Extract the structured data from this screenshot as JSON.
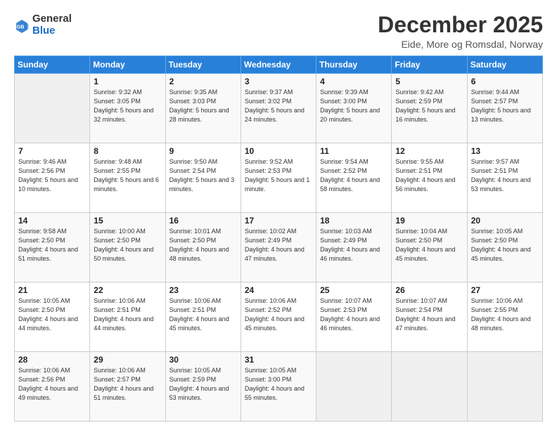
{
  "logo": {
    "general": "General",
    "blue": "Blue"
  },
  "header": {
    "month": "December 2025",
    "location": "Eide, More og Romsdal, Norway"
  },
  "weekdays": [
    "Sunday",
    "Monday",
    "Tuesday",
    "Wednesday",
    "Thursday",
    "Friday",
    "Saturday"
  ],
  "weeks": [
    [
      {
        "day": null,
        "info": null
      },
      {
        "day": "1",
        "info": "Sunrise: 9:32 AM\nSunset: 3:05 PM\nDaylight: 5 hours\nand 32 minutes."
      },
      {
        "day": "2",
        "info": "Sunrise: 9:35 AM\nSunset: 3:03 PM\nDaylight: 5 hours\nand 28 minutes."
      },
      {
        "day": "3",
        "info": "Sunrise: 9:37 AM\nSunset: 3:02 PM\nDaylight: 5 hours\nand 24 minutes."
      },
      {
        "day": "4",
        "info": "Sunrise: 9:39 AM\nSunset: 3:00 PM\nDaylight: 5 hours\nand 20 minutes."
      },
      {
        "day": "5",
        "info": "Sunrise: 9:42 AM\nSunset: 2:59 PM\nDaylight: 5 hours\nand 16 minutes."
      },
      {
        "day": "6",
        "info": "Sunrise: 9:44 AM\nSunset: 2:57 PM\nDaylight: 5 hours\nand 13 minutes."
      }
    ],
    [
      {
        "day": "7",
        "info": "Sunrise: 9:46 AM\nSunset: 2:56 PM\nDaylight: 5 hours\nand 10 minutes."
      },
      {
        "day": "8",
        "info": "Sunrise: 9:48 AM\nSunset: 2:55 PM\nDaylight: 5 hours\nand 6 minutes."
      },
      {
        "day": "9",
        "info": "Sunrise: 9:50 AM\nSunset: 2:54 PM\nDaylight: 5 hours\nand 3 minutes."
      },
      {
        "day": "10",
        "info": "Sunrise: 9:52 AM\nSunset: 2:53 PM\nDaylight: 5 hours\nand 1 minute."
      },
      {
        "day": "11",
        "info": "Sunrise: 9:54 AM\nSunset: 2:52 PM\nDaylight: 4 hours\nand 58 minutes."
      },
      {
        "day": "12",
        "info": "Sunrise: 9:55 AM\nSunset: 2:51 PM\nDaylight: 4 hours\nand 56 minutes."
      },
      {
        "day": "13",
        "info": "Sunrise: 9:57 AM\nSunset: 2:51 PM\nDaylight: 4 hours\nand 53 minutes."
      }
    ],
    [
      {
        "day": "14",
        "info": "Sunrise: 9:58 AM\nSunset: 2:50 PM\nDaylight: 4 hours\nand 51 minutes."
      },
      {
        "day": "15",
        "info": "Sunrise: 10:00 AM\nSunset: 2:50 PM\nDaylight: 4 hours\nand 50 minutes."
      },
      {
        "day": "16",
        "info": "Sunrise: 10:01 AM\nSunset: 2:50 PM\nDaylight: 4 hours\nand 48 minutes."
      },
      {
        "day": "17",
        "info": "Sunrise: 10:02 AM\nSunset: 2:49 PM\nDaylight: 4 hours\nand 47 minutes."
      },
      {
        "day": "18",
        "info": "Sunrise: 10:03 AM\nSunset: 2:49 PM\nDaylight: 4 hours\nand 46 minutes."
      },
      {
        "day": "19",
        "info": "Sunrise: 10:04 AM\nSunset: 2:50 PM\nDaylight: 4 hours\nand 45 minutes."
      },
      {
        "day": "20",
        "info": "Sunrise: 10:05 AM\nSunset: 2:50 PM\nDaylight: 4 hours\nand 45 minutes."
      }
    ],
    [
      {
        "day": "21",
        "info": "Sunrise: 10:05 AM\nSunset: 2:50 PM\nDaylight: 4 hours\nand 44 minutes."
      },
      {
        "day": "22",
        "info": "Sunrise: 10:06 AM\nSunset: 2:51 PM\nDaylight: 4 hours\nand 44 minutes."
      },
      {
        "day": "23",
        "info": "Sunrise: 10:06 AM\nSunset: 2:51 PM\nDaylight: 4 hours\nand 45 minutes."
      },
      {
        "day": "24",
        "info": "Sunrise: 10:06 AM\nSunset: 2:52 PM\nDaylight: 4 hours\nand 45 minutes."
      },
      {
        "day": "25",
        "info": "Sunrise: 10:07 AM\nSunset: 2:53 PM\nDaylight: 4 hours\nand 46 minutes."
      },
      {
        "day": "26",
        "info": "Sunrise: 10:07 AM\nSunset: 2:54 PM\nDaylight: 4 hours\nand 47 minutes."
      },
      {
        "day": "27",
        "info": "Sunrise: 10:06 AM\nSunset: 2:55 PM\nDaylight: 4 hours\nand 48 minutes."
      }
    ],
    [
      {
        "day": "28",
        "info": "Sunrise: 10:06 AM\nSunset: 2:56 PM\nDaylight: 4 hours\nand 49 minutes."
      },
      {
        "day": "29",
        "info": "Sunrise: 10:06 AM\nSunset: 2:57 PM\nDaylight: 4 hours\nand 51 minutes."
      },
      {
        "day": "30",
        "info": "Sunrise: 10:05 AM\nSunset: 2:59 PM\nDaylight: 4 hours\nand 53 minutes."
      },
      {
        "day": "31",
        "info": "Sunrise: 10:05 AM\nSunset: 3:00 PM\nDaylight: 4 hours\nand 55 minutes."
      },
      {
        "day": null,
        "info": null
      },
      {
        "day": null,
        "info": null
      },
      {
        "day": null,
        "info": null
      }
    ]
  ]
}
